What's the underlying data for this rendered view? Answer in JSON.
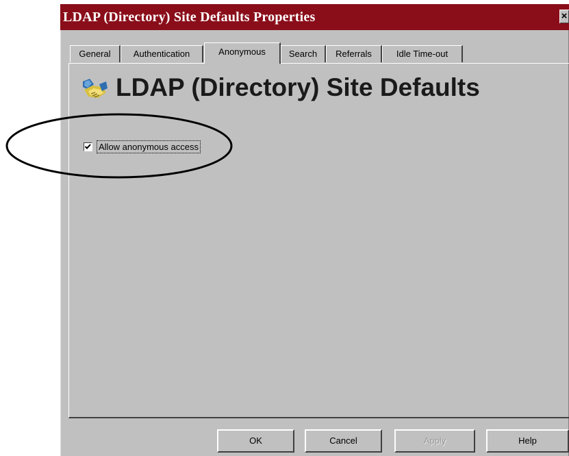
{
  "window": {
    "title": "LDAP (Directory) Site Defaults Properties",
    "close_label": "×"
  },
  "tabs": [
    {
      "label": "General",
      "active": false
    },
    {
      "label": "Authentication",
      "active": false
    },
    {
      "label": "Anonymous",
      "active": true
    },
    {
      "label": "Search",
      "active": false
    },
    {
      "label": "Referrals",
      "active": false
    },
    {
      "label": "Idle Time-out",
      "active": false
    }
  ],
  "panel": {
    "icon": "handshake-icon",
    "title": "LDAP (Directory) Site Defaults",
    "checkbox": {
      "label": "Allow anonymous access",
      "checked": true
    }
  },
  "buttons": {
    "ok": "OK",
    "cancel": "Cancel",
    "apply": "Apply",
    "help": "Help"
  },
  "colors": {
    "title_bar": "#8a0e1a",
    "dialog_face": "#c0c0c0",
    "annotation": "#000000"
  }
}
